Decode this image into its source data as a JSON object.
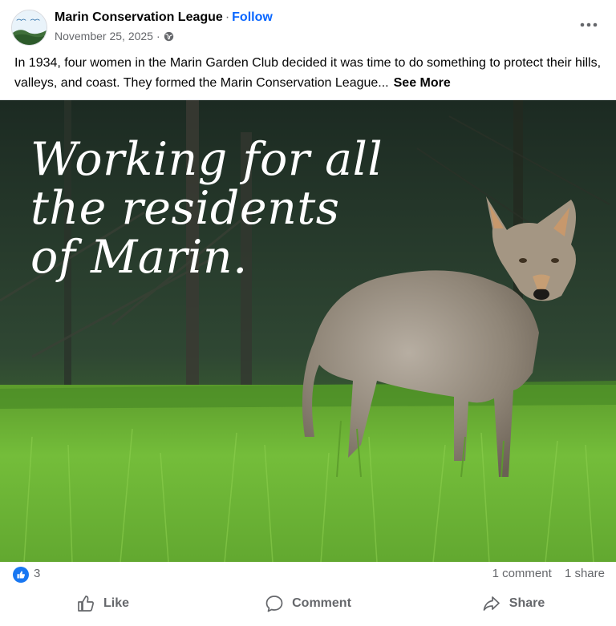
{
  "post": {
    "page_name": "Marin Conservation League",
    "separator": "·",
    "follow_label": "Follow",
    "date": "November 25, 2025",
    "date_separator": "·",
    "privacy_icon": "globe-icon",
    "more_icon": "more-options-icon",
    "avatar_text": [
      "MARIN",
      "CONSERVATION",
      "LEAGUE"
    ],
    "text": "In 1934, four women in the Marin Garden Club decided it was time to do something to protect their hills, valleys, and coast. They formed the Marin Conservation League...",
    "see_more_label": "See More"
  },
  "photo": {
    "overlay_lines": [
      "Working for all",
      "the residents",
      "of Marin."
    ],
    "subject": "coyote standing in green grass"
  },
  "reactions": {
    "icon": "thumbs-up-icon",
    "count": "3",
    "comments": "1 comment",
    "shares": "1 share"
  },
  "actions": {
    "like_label": "Like",
    "comment_label": "Comment",
    "share_label": "Share"
  },
  "colors": {
    "link": "#0866ff",
    "like_badge": "#1877f2",
    "muted_text": "#65676b"
  }
}
